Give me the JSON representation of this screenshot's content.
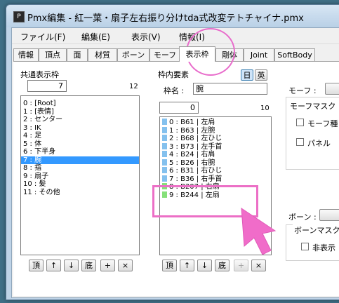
{
  "window": {
    "title": "Pmx編集 - 紅一葉・扇子左右振り分けtda式改変テトチャイナ.pmx"
  },
  "menu": [
    "ファイル(F)",
    "編集(E)",
    "表示(V)",
    "情報(I)"
  ],
  "tabs": [
    "情報",
    "頂点",
    "面",
    "材質",
    "ボーン",
    "モーフ",
    "表示枠",
    "剛体",
    "Joint",
    "SoftBody"
  ],
  "active_tab": "表示枠",
  "left": {
    "header": "共通表示枠",
    "count_value": "7",
    "count_total": "12",
    "items": [
      "0 : [Root]",
      "1 : [表情]",
      "2 : センター",
      "3 : IK",
      "4 : 足",
      "5 : 体",
      "6 : 下半身",
      "7 : 腕",
      "8 : 指",
      "9 : 扇子",
      "10 : 髪",
      "11 : その他"
    ],
    "selected_index": 7,
    "buttons": [
      "頂",
      "↑",
      "↓",
      "底",
      "+",
      "×"
    ]
  },
  "middle": {
    "header": "枠内要素",
    "lang_buttons": [
      "日",
      "英"
    ],
    "name_label": "枠名 :",
    "name_value": "腕",
    "count_value": "0",
    "count_total": "10",
    "items": [
      {
        "text": "0 : B61 | 左肩",
        "color": "#84c1ee"
      },
      {
        "text": "1 : B63 | 左腕",
        "color": "#84c1ee"
      },
      {
        "text": "2 : B68 | 左ひじ",
        "color": "#84c1ee"
      },
      {
        "text": "3 : B73 | 左手首",
        "color": "#84c1ee"
      },
      {
        "text": "4 : B24 | 右肩",
        "color": "#84c1ee"
      },
      {
        "text": "5 : B26 | 右腕",
        "color": "#84c1ee"
      },
      {
        "text": "6 : B31 | 右ひじ",
        "color": "#84c1ee"
      },
      {
        "text": "7 : B36 | 右手首",
        "color": "#84c1ee"
      },
      {
        "text": "8 : B207 | 右扇",
        "color": "#86e07a"
      },
      {
        "text": "9 : B244 | 左扇",
        "color": "#86e07a"
      }
    ],
    "buttons": [
      "頂",
      "↑",
      "↓",
      "底",
      "+",
      "×"
    ]
  },
  "right": {
    "morph_label": "モーフ :",
    "morph_mask_label": "モーフマスク",
    "morph_check1": "モーフ種",
    "morph_check2": "パネル",
    "bone_label": "ボーン :",
    "bone_mask_label": "ボーンマスク",
    "bone_check1": "非表示"
  }
}
